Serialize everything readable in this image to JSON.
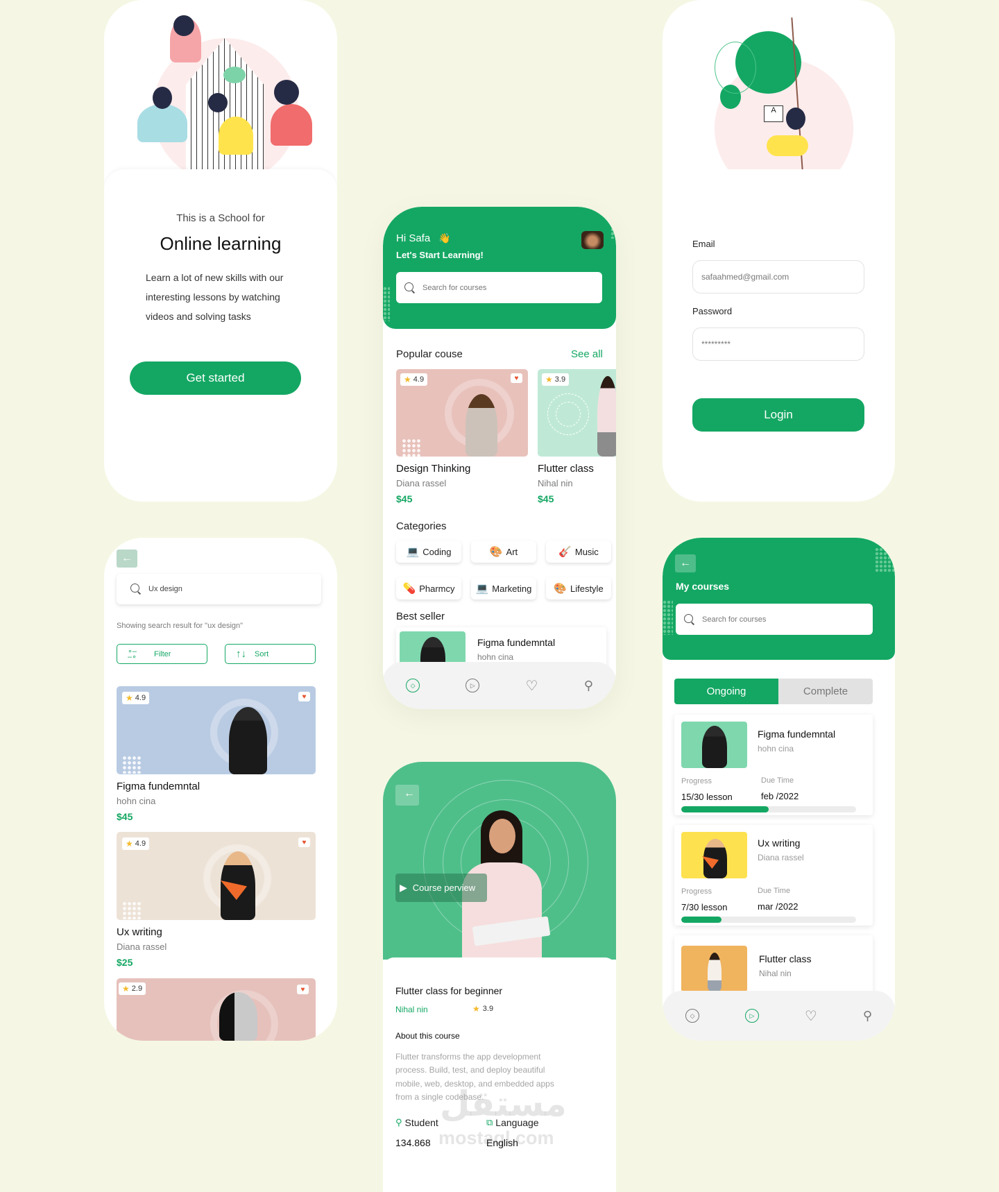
{
  "colors": {
    "accent": "#14a763",
    "background": "#f5f7e4",
    "heart": "#e6532f",
    "star": "#f5b92a"
  },
  "onboarding": {
    "overline": "This is a School for",
    "title": "Online learning",
    "description_lines": [
      "Learn a lot of new skills with our",
      "interesting lessons by watching",
      "videos and solving tasks"
    ],
    "cta_label": "Get started"
  },
  "home": {
    "greeting": "Hi Safa",
    "greeting_emoji": "👋",
    "subtitle": "Let's Start Learning!",
    "search_placeholder": "Search for courses",
    "popular_title": "Popular couse",
    "see_all": "See all",
    "popular": [
      {
        "rating": "4.9",
        "title": "Design Thinking",
        "author": "Diana rassel",
        "price": "$45",
        "color": "#e8c1bb"
      },
      {
        "rating": "3.9",
        "title": "Flutter class",
        "author": "Nihal nin",
        "price": "$45",
        "color": "#bfe9d6"
      }
    ],
    "categories_title": "Categories",
    "categories": [
      {
        "icon": "💻",
        "label": "Coding",
        "icon_name": "laptop-icon"
      },
      {
        "icon": "🎨",
        "label": "Art",
        "icon_name": "palette-icon"
      },
      {
        "icon": "🎸",
        "label": "Music",
        "icon_name": "guitar-icon"
      },
      {
        "icon": "💊",
        "label": "Pharmcy",
        "icon_name": "pill-icon"
      },
      {
        "icon": "💻",
        "label": "Marketing",
        "icon_name": "laptop-icon"
      },
      {
        "icon": "🎨",
        "label": "Lifestyle",
        "icon_name": "palette-icon"
      }
    ],
    "best_seller_title": "Best seller",
    "best_seller": {
      "title": "Figma fundemntal",
      "author": "hohn cina"
    },
    "tabs": [
      "explore",
      "play",
      "favorites",
      "profile"
    ],
    "active_tab": "explore"
  },
  "login": {
    "email_label": "Email",
    "email_value": "safaahmed@gmail.com",
    "password_label": "Password",
    "password_value": "*********",
    "login_label": "Login"
  },
  "search": {
    "query": "Ux design",
    "result_text": "Showing search result for \"ux design\"",
    "filter_label": "Filter",
    "sort_label": "Sort",
    "results": [
      {
        "rating": "4.9",
        "title": "Figma fundemntal",
        "author": "hohn cina",
        "price": "$45",
        "color": "#b9cbe3"
      },
      {
        "rating": "4.9",
        "title": "Ux writing",
        "author": "Diana rassel",
        "price": "$25",
        "color": "#ede2d6"
      },
      {
        "rating": "2.9",
        "title": "",
        "author": "",
        "price": "",
        "color": "#e6c1bb"
      }
    ]
  },
  "detail": {
    "preview_label": "Course  perview",
    "title": "Flutter class for beginner",
    "author": "Nihal nin",
    "rating": "3.9",
    "about_title": "About this course",
    "about_lines": [
      "Flutter transforms the app development",
      "process. Build, test, and deploy beautiful",
      "mobile, web, desktop, and embedded apps",
      "from a single codebase."
    ],
    "student_label": "Student",
    "student_value": "134.868",
    "language_label": "Language",
    "language_value": "English",
    "watermark": "mostaql.com",
    "watermark_ar": "مستقل"
  },
  "my_courses": {
    "title": "My courses",
    "search_placeholder": "Search for courses",
    "tab_ongoing": "Ongoing",
    "tab_complete": "Complete",
    "progress_label": "Progress",
    "due_label": "Due Time",
    "courses": [
      {
        "title": "Figma fundemntal",
        "author": "hohn cina",
        "progress_text": "15/30 lesson",
        "progress": 0.5,
        "due": "feb /2022",
        "color": "#7fd7ae"
      },
      {
        "title": "Ux writing",
        "author": "Diana rassel",
        "progress_text": "7/30 lesson",
        "progress": 0.23,
        "due": "mar /2022",
        "color": "#fde14f"
      },
      {
        "title": "Flutter class",
        "author": "Nihal nin",
        "color": "#f0b45e"
      }
    ],
    "active_tab": "play"
  }
}
